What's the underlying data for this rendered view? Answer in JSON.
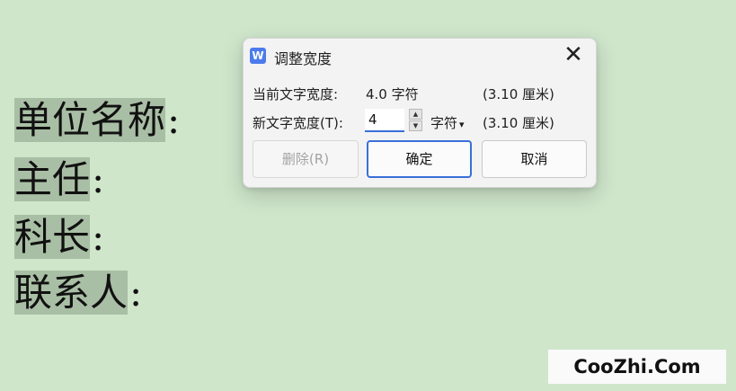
{
  "document": {
    "lines": [
      {
        "text": "单位名称",
        "colon": ":"
      },
      {
        "text": "主任",
        "colon": ":"
      },
      {
        "text": "科长",
        "colon": ":"
      },
      {
        "text": "联系人",
        "colon": ":"
      }
    ]
  },
  "dialog": {
    "app_icon": "W",
    "title": "调整宽度",
    "close_glyph": "✕",
    "current_label": "当前文字宽度:",
    "current_value": "4.0 字符",
    "current_metric": "(3.10 厘米)",
    "new_label": "新文字宽度(T):",
    "new_value": "4",
    "unit": "字符",
    "unit_arrow": "▾",
    "new_metric": "(3.10 厘米)",
    "buttons": {
      "delete": "删除(R)",
      "ok": "确定",
      "cancel": "取消"
    },
    "spin_up": "▲",
    "spin_down": "▼"
  },
  "watermark": "CooZhi.Com",
  "colors": {
    "background": "#cfe6cb",
    "highlight": "#a9bfa5",
    "accent": "#3a6fd8"
  }
}
